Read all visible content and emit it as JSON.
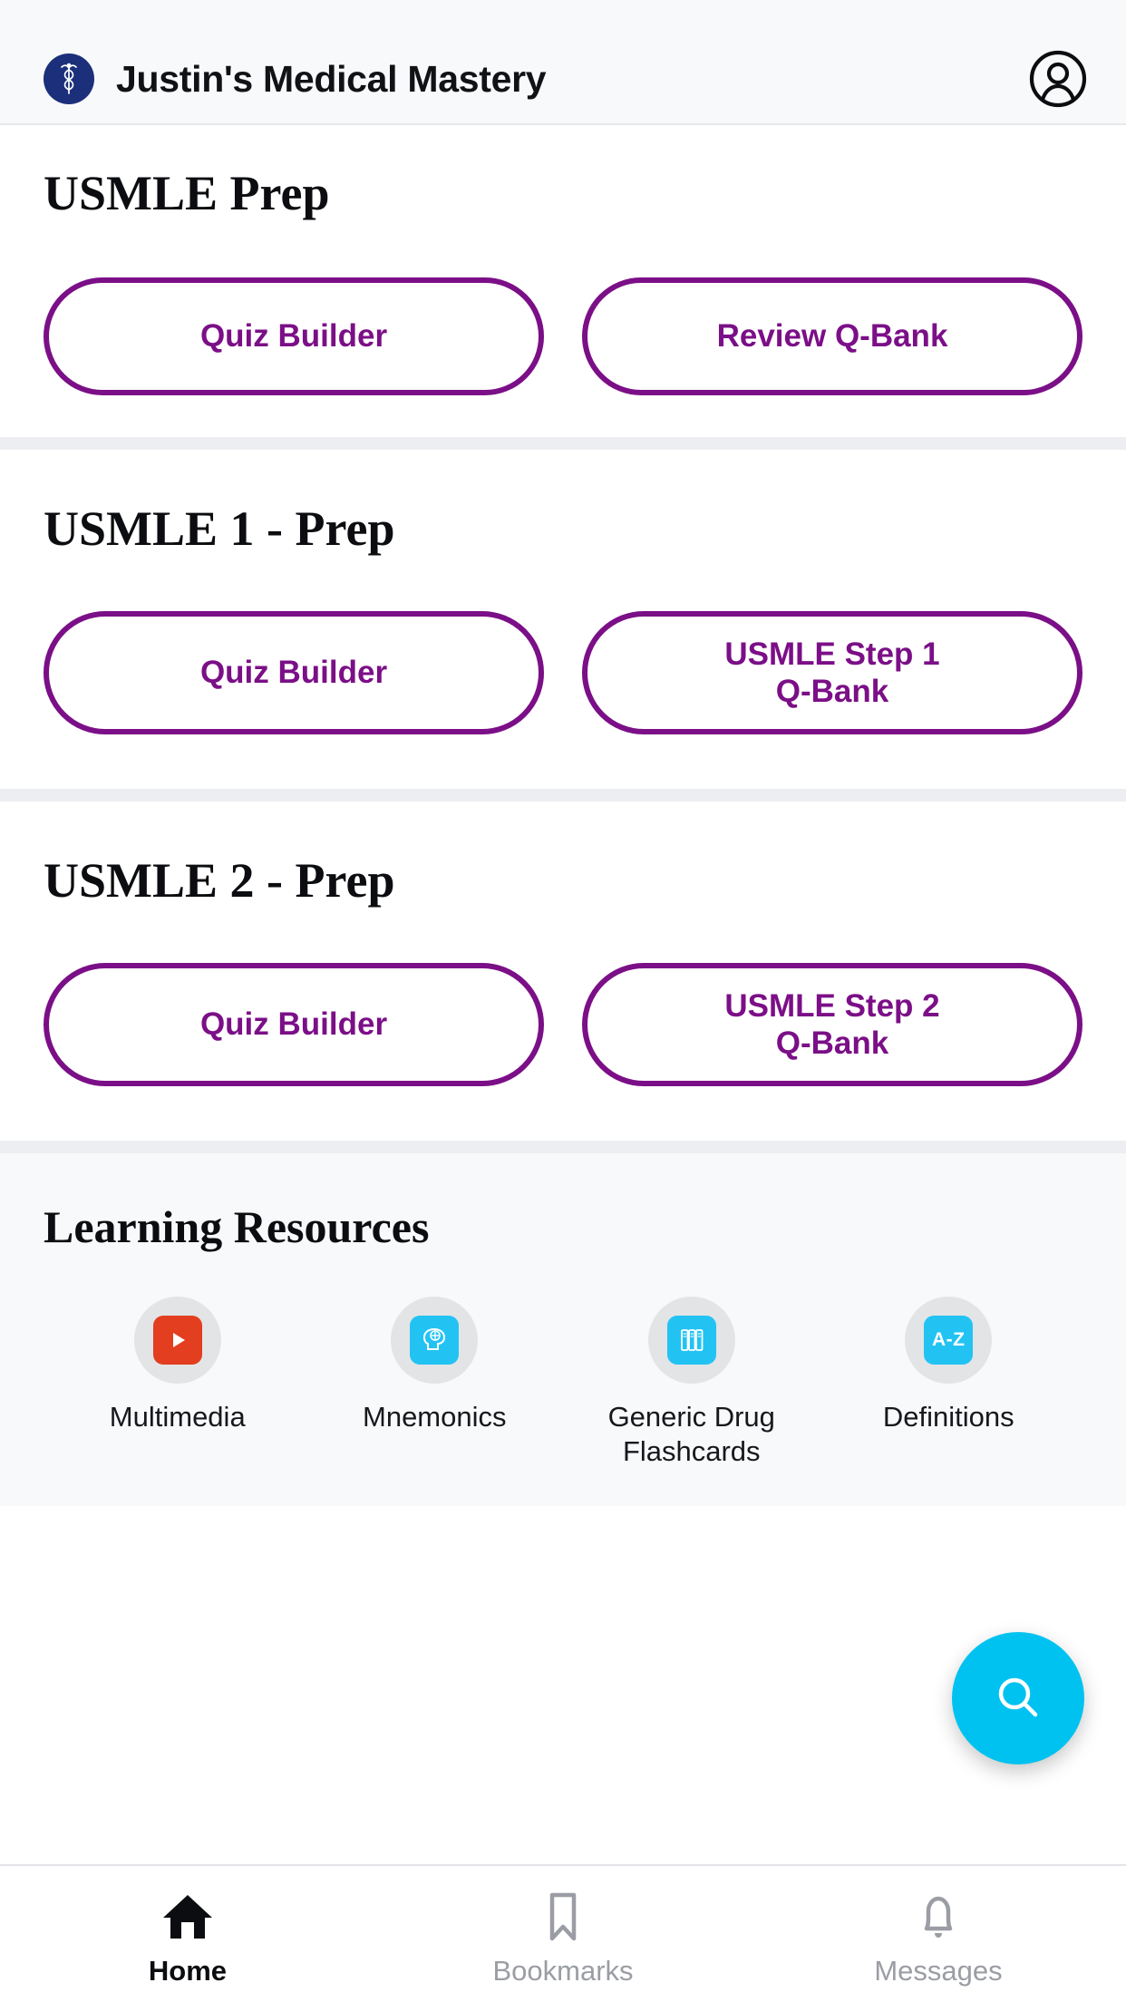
{
  "header": {
    "title": "Justin's Medical Mastery",
    "logo_icon": "caduceus-icon",
    "avatar_icon": "account-circle-icon"
  },
  "sections": [
    {
      "title": "USMLE Prep",
      "buttons": [
        {
          "label": "Quiz Builder"
        },
        {
          "label": "Review Q-Bank"
        }
      ]
    },
    {
      "title": "USMLE 1 - Prep",
      "buttons": [
        {
          "label": "Quiz Builder"
        },
        {
          "label": "USMLE Step 1\nQ-Bank"
        }
      ]
    },
    {
      "title": "USMLE 2 - Prep",
      "buttons": [
        {
          "label": "Quiz Builder"
        },
        {
          "label": "USMLE Step 2\nQ-Bank"
        }
      ]
    }
  ],
  "resources": {
    "title": "Learning Resources",
    "items": [
      {
        "label": "Multimedia",
        "icon": "play-video-icon",
        "tile_color": "#e23e1f"
      },
      {
        "label": "Mnemonics",
        "icon": "brain-head-icon",
        "tile_color": "#22c3f3"
      },
      {
        "label": "Generic Drug Flashcards",
        "icon": "book-spines-icon",
        "tile_color": "#22c3f3"
      },
      {
        "label": "Definitions",
        "icon": "a-z-icon",
        "tile_color": "#22c3f3",
        "tile_text": "A-Z"
      }
    ]
  },
  "fab": {
    "icon": "search-icon",
    "color": "#00c2f0"
  },
  "bottom_nav": {
    "items": [
      {
        "label": "Home",
        "icon": "home-icon",
        "active": true
      },
      {
        "label": "Bookmarks",
        "icon": "bookmark-icon",
        "active": false
      },
      {
        "label": "Messages",
        "icon": "bell-icon",
        "active": false
      }
    ]
  },
  "theme": {
    "accent_purple": "#7b0f87",
    "accent_cyan": "#00c2f0",
    "logo_navy": "#1b2f7a"
  }
}
